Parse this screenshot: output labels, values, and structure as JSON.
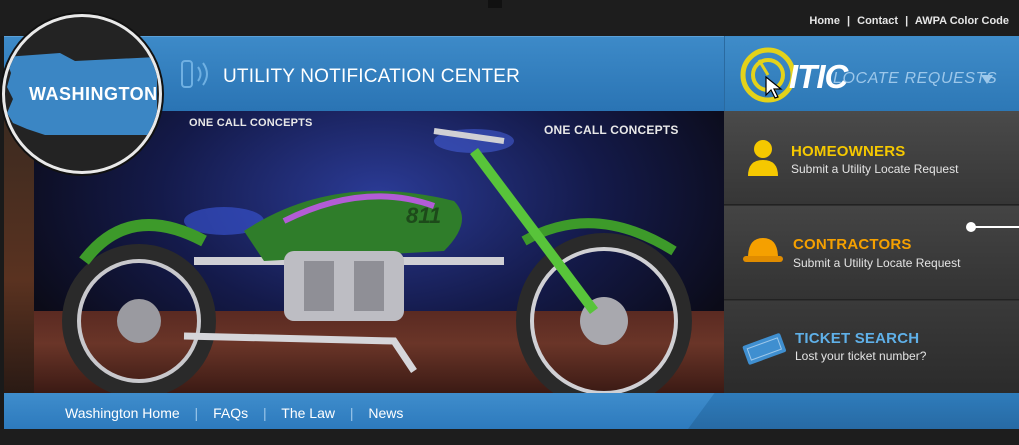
{
  "top_links": {
    "home": "Home",
    "contact": "Contact",
    "awpa": "AWPA Color Code",
    "separator": "|"
  },
  "logo": {
    "text": "WASHINGTON"
  },
  "header": {
    "title": "UTILITY NOTIFICATION CENTER"
  },
  "itic": {
    "brand": "ITIC",
    "label": "LOCATE REQUESTS"
  },
  "photo": {
    "banner_left": "ONE CALL CONCEPTS",
    "banner_right": "ONE CALL CONCEPTS",
    "bike_number": "811"
  },
  "panels": [
    {
      "title": "HOMEOWNERS",
      "subtitle": "Submit a Utility Locate Request",
      "icon": "person-icon",
      "color": "#f5c800"
    },
    {
      "title": "CONTRACTORS",
      "subtitle": "Submit a Utility Locate Request",
      "icon": "hard-hat-icon",
      "color": "#f5a000"
    },
    {
      "title": "TICKET SEARCH",
      "subtitle": "Lost your ticket number?",
      "icon": "ticket-icon",
      "color": "#5fb0e8"
    }
  ],
  "nav": {
    "items": [
      "Washington Home",
      "FAQs",
      "The Law",
      "News"
    ],
    "separator": "|"
  },
  "colors": {
    "header_blue": "#2a74b4",
    "accent_yellow": "#f5c800",
    "accent_orange": "#f5a000",
    "accent_light_blue": "#5fb0e8"
  }
}
